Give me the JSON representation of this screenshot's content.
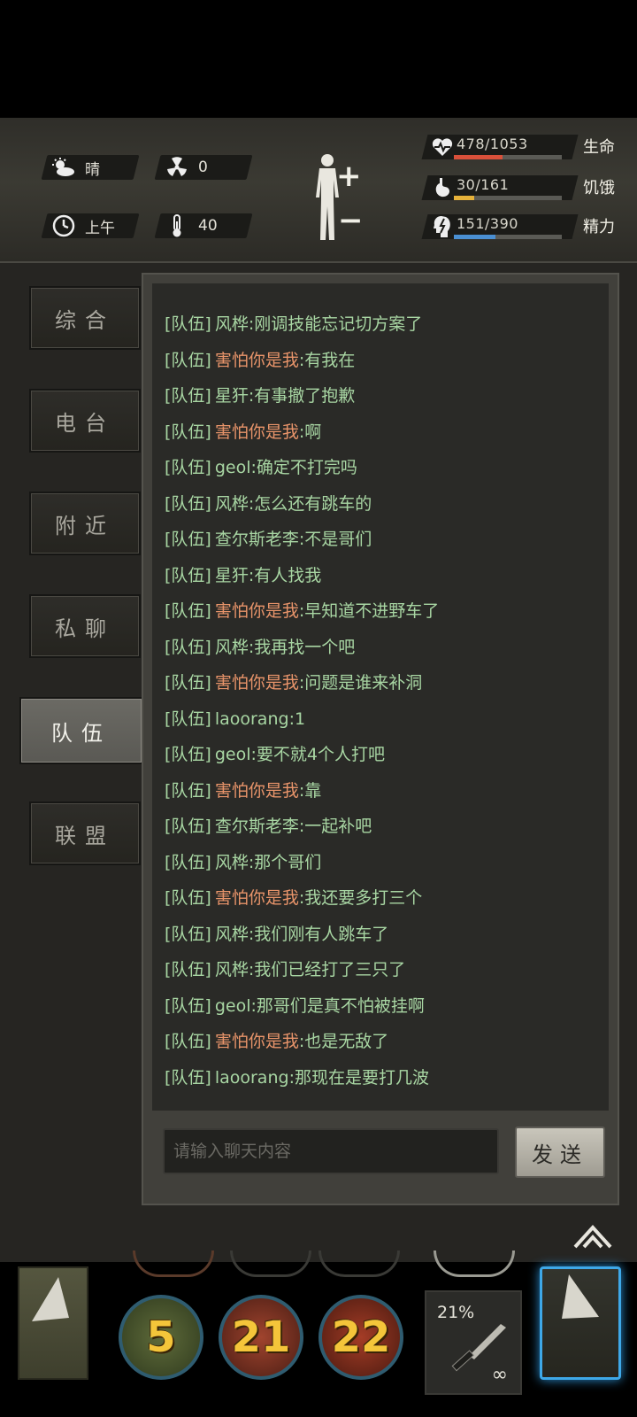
{
  "status": {
    "weather": "晴",
    "radiation": "0",
    "time_of_day": "上午",
    "temperature": "40",
    "stats": [
      {
        "value": "478/1053",
        "label": "生命",
        "fraction": 0.454,
        "color": "#d9503a"
      },
      {
        "value": "30/161",
        "label": "饥饿",
        "fraction": 0.186,
        "color": "#e6b23a"
      },
      {
        "value": "151/390",
        "label": "精力",
        "fraction": 0.387,
        "color": "#4a8fd2"
      }
    ]
  },
  "tabs": [
    {
      "label": "综合",
      "active": false
    },
    {
      "label": "电台",
      "active": false
    },
    {
      "label": "附近",
      "active": false
    },
    {
      "label": "私聊",
      "active": false
    },
    {
      "label": "队伍",
      "active": true
    },
    {
      "label": "联盟",
      "active": false
    }
  ],
  "chat": {
    "messages": [
      {
        "channel": "[队伍]",
        "name": "风桦",
        "text": ":刚调技能忘记切方案了",
        "highlight": false
      },
      {
        "channel": "[队伍]",
        "name": "害怕你是我",
        "text": ":有我在",
        "highlight": true
      },
      {
        "channel": "[队伍]",
        "name": "星犴",
        "text": ":有事撤了抱歉",
        "highlight": false
      },
      {
        "channel": "[队伍]",
        "name": "害怕你是我",
        "text": ":啊",
        "highlight": true
      },
      {
        "channel": "[队伍]",
        "name": "geol",
        "text": ":确定不打完吗",
        "highlight": false
      },
      {
        "channel": "[队伍]",
        "name": "风桦",
        "text": ":怎么还有跳车的",
        "highlight": false
      },
      {
        "channel": "[队伍]",
        "name": "查尔斯老李",
        "text": ":不是哥们",
        "highlight": false
      },
      {
        "channel": "[队伍]",
        "name": "星犴",
        "text": ":有人找我",
        "highlight": false
      },
      {
        "channel": "[队伍]",
        "name": "害怕你是我",
        "text": ":早知道不进野车了",
        "highlight": true
      },
      {
        "channel": "[队伍]",
        "name": "风桦",
        "text": ":我再找一个吧",
        "highlight": false
      },
      {
        "channel": "[队伍]",
        "name": "害怕你是我",
        "text": ":问题是谁来补洞",
        "highlight": true
      },
      {
        "channel": "[队伍]",
        "name": "laoorang",
        "text": ":1",
        "highlight": false
      },
      {
        "channel": "[队伍]",
        "name": "geol",
        "text": ":要不就4个人打吧",
        "highlight": false
      },
      {
        "channel": "[队伍]",
        "name": "害怕你是我",
        "text": ":靠",
        "highlight": true
      },
      {
        "channel": "[队伍]",
        "name": "查尔斯老李",
        "text": ":一起补吧",
        "highlight": false
      },
      {
        "channel": "[队伍]",
        "name": "风桦",
        "text": ":那个哥们",
        "highlight": false
      },
      {
        "channel": "[队伍]",
        "name": "害怕你是我",
        "text": ":我还要多打三个",
        "highlight": true
      },
      {
        "channel": "[队伍]",
        "name": "风桦",
        "text": ":我们刚有人跳车了",
        "highlight": false
      },
      {
        "channel": "[队伍]",
        "name": "风桦",
        "text": ":我们已经打了三只了",
        "highlight": false
      },
      {
        "channel": "[队伍]",
        "name": "geol",
        "text": ":那哥们是真不怕被挂啊",
        "highlight": false
      },
      {
        "channel": "[队伍]",
        "name": "害怕你是我",
        "text": ":也是无敌了",
        "highlight": true
      },
      {
        "channel": "[队伍]",
        "name": "laoorang",
        "text": ":那现在是要打几波",
        "highlight": false
      }
    ],
    "input_placeholder": "请输入聊天内容",
    "send_label": "发送"
  },
  "skills": [
    {
      "value": "5",
      "icon": "heal-icon"
    },
    {
      "value": "21",
      "icon": "fist-icon"
    },
    {
      "value": "22",
      "icon": "blade-icon"
    }
  ],
  "weapon": {
    "durability": "21%",
    "ammo": "∞",
    "icon": "knife-icon"
  }
}
